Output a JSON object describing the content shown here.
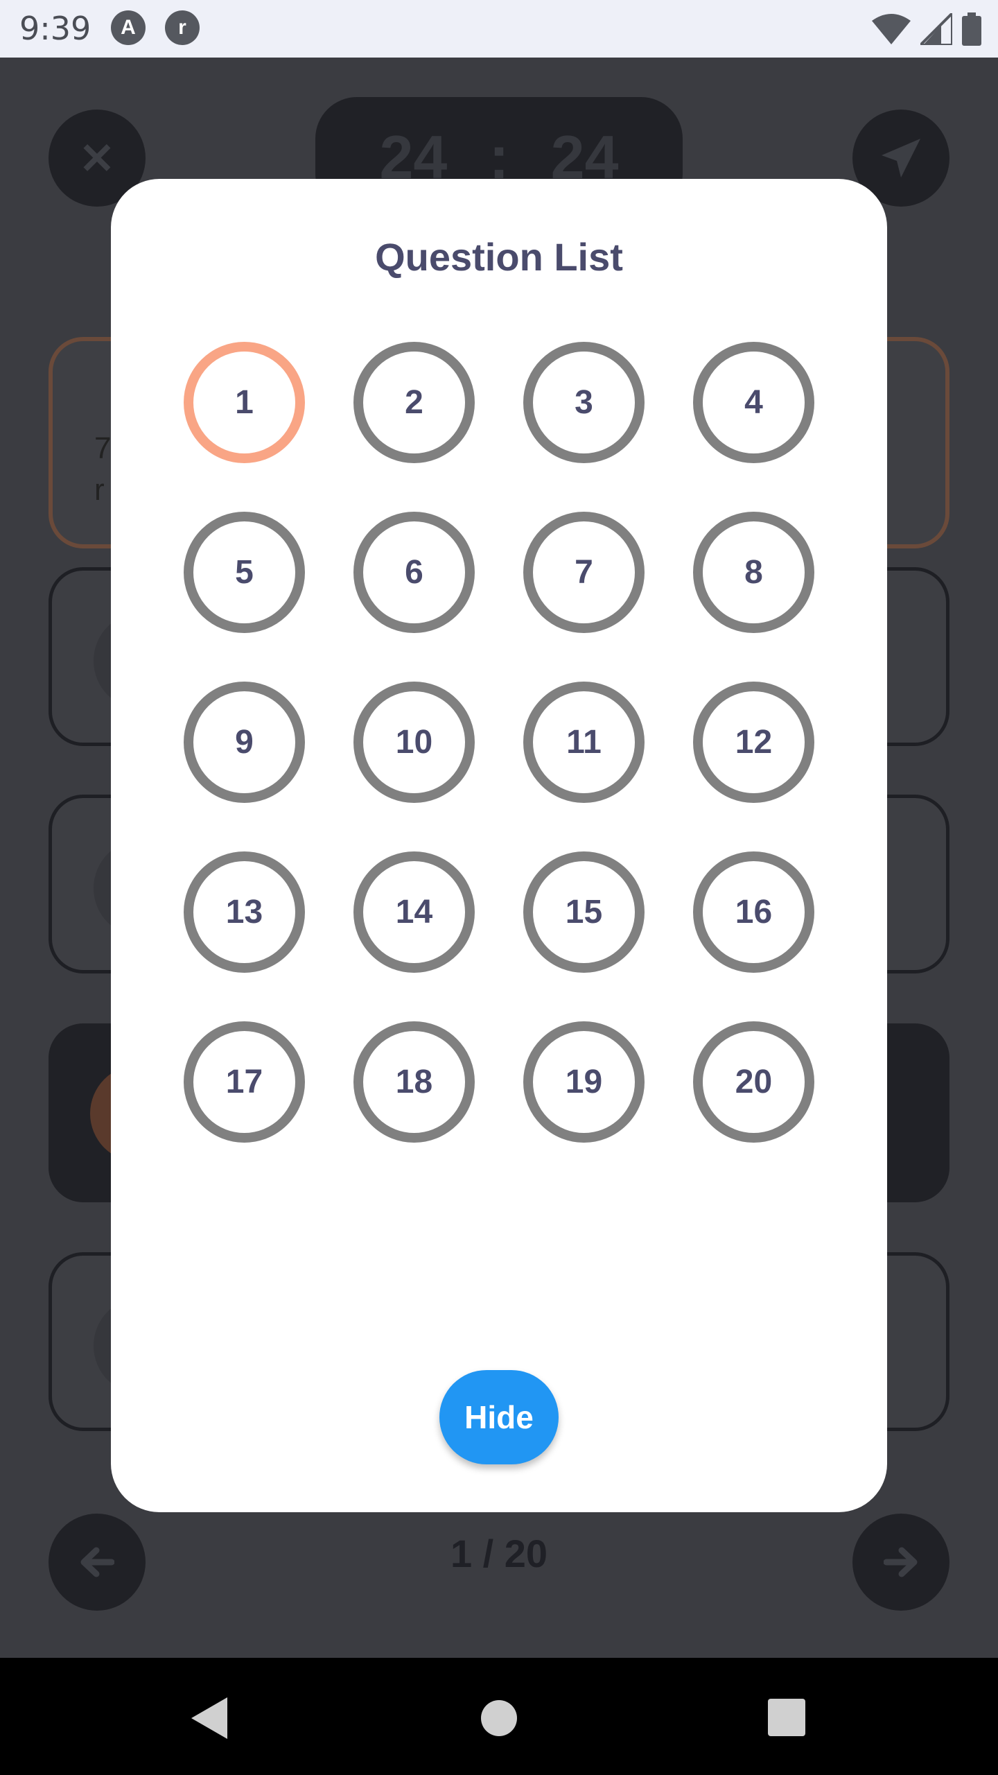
{
  "status_bar": {
    "time": "9:39",
    "app_icons": [
      "A",
      "r"
    ]
  },
  "background": {
    "close_glyph": "✕",
    "timer": {
      "minutes": "24",
      "separator": ":",
      "seconds": "24"
    },
    "question_text_line1": "7",
    "question_text_line2": "r",
    "pagination": "1 / 20"
  },
  "modal": {
    "title": "Question List",
    "questions": [
      "1",
      "2",
      "3",
      "4",
      "5",
      "6",
      "7",
      "8",
      "9",
      "10",
      "11",
      "12",
      "13",
      "14",
      "15",
      "16",
      "17",
      "18",
      "19",
      "20"
    ],
    "active_question": "1",
    "hide_label": "Hide"
  },
  "colors": {
    "active_ring": "#f9a585",
    "inactive_ring": "#808080",
    "number_text": "#4a4b6c",
    "hide_button": "#2196f3"
  }
}
